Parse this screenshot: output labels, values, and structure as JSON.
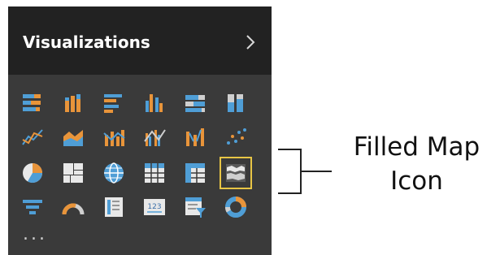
{
  "panel": {
    "title": "Visualizations",
    "more_label": "...",
    "selected_visual": "filled-map",
    "colors": {
      "header_bg": "#222222",
      "panel_bg": "#3a3a3a",
      "selection": "#e8c545",
      "accent_blue": "#4f9ed6",
      "accent_orange": "#e8943a"
    }
  },
  "visuals": [
    [
      "stacked-bar-chart-icon",
      "stacked-column-chart-icon",
      "clustered-bar-chart-icon",
      "clustered-column-chart-icon",
      "100-stacked-bar-chart-icon",
      "100-stacked-column-chart-icon"
    ],
    [
      "line-chart-icon",
      "area-chart-icon",
      "line-and-stacked-column-chart-icon",
      "line-and-clustered-column-chart-icon",
      "ribbon-chart-icon",
      "scatter-chart-icon"
    ],
    [
      "pie-chart-icon",
      "treemap-icon",
      "map-icon",
      "table-icon",
      "matrix-icon",
      "filled-map-icon"
    ],
    [
      "funnel-icon",
      "gauge-icon",
      "multi-row-card-icon",
      "card-icon",
      "slicer-icon",
      "donut-chart-icon"
    ]
  ],
  "callout": {
    "line1": "Filled Map",
    "line2": "Icon"
  }
}
